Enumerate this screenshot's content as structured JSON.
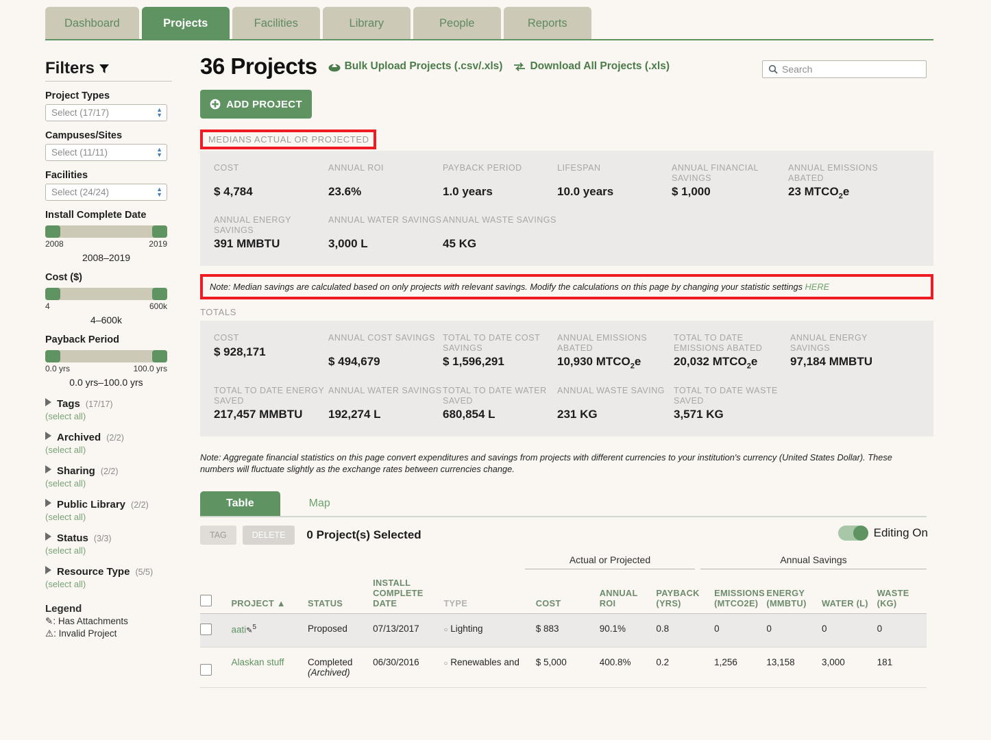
{
  "nav": {
    "tabs": [
      {
        "label": "Dashboard",
        "active": false
      },
      {
        "label": "Projects",
        "active": true
      },
      {
        "label": "Facilities",
        "active": false
      },
      {
        "label": "Library",
        "active": false
      },
      {
        "label": "People",
        "active": false
      },
      {
        "label": "Reports",
        "active": false
      }
    ]
  },
  "sidebar": {
    "heading": "Filters",
    "filter_icon": "funnel-icon",
    "selects": [
      {
        "label": "Project Types",
        "value": "Select (17/17)"
      },
      {
        "label": "Campuses/Sites",
        "value": "Select (11/11)"
      },
      {
        "label": "Facilities",
        "value": "Select (24/24)"
      }
    ],
    "sliders": [
      {
        "label": "Install Complete Date",
        "min": "2008",
        "max": "2019",
        "range": "2008–2019"
      },
      {
        "label": "Cost ($)",
        "min": "4",
        "max": "600k",
        "range": "4–600k"
      },
      {
        "label": "Payback Period",
        "min": "0.0 yrs",
        "max": "100.0 yrs",
        "range": "0.0 yrs–100.0 yrs"
      }
    ],
    "accordions": [
      {
        "title": "Tags",
        "count": "(17/17)",
        "select_all": "(select all)"
      },
      {
        "title": "Archived",
        "count": "(2/2)",
        "select_all": "(select all)"
      },
      {
        "title": "Sharing",
        "count": "(2/2)",
        "select_all": "(select all)"
      },
      {
        "title": "Public Library",
        "count": "(2/2)",
        "select_all": "(select all)"
      },
      {
        "title": "Status",
        "count": "(3/3)",
        "select_all": "(select all)"
      },
      {
        "title": "Resource Type",
        "count": "(5/5)",
        "select_all": "(select all)"
      }
    ],
    "legend": {
      "title": "Legend",
      "items": [
        {
          "icon": "paperclip-icon",
          "glyph": "✎",
          "text": ": Has Attachments"
        },
        {
          "icon": "warning-triangle-icon",
          "glyph": "⚠",
          "text": ": Invalid Project"
        }
      ]
    }
  },
  "header": {
    "title": "36 Projects",
    "bulk_upload": "Bulk Upload Projects (.csv/.xls)",
    "download_all": "Download All Projects (.xls)",
    "add_project": "ADD PROJECT",
    "search_placeholder": "Search",
    "search_value": ""
  },
  "medians": {
    "section_label": "MEDIANS ACTUAL OR PROJECTED",
    "row1": [
      {
        "key": "COST",
        "value": "$ 4,784"
      },
      {
        "key": "ANNUAL ROI",
        "value": "23.6%"
      },
      {
        "key": "PAYBACK PERIOD",
        "value": "1.0 years"
      },
      {
        "key": "LIFESPAN",
        "value": "10.0 years"
      },
      {
        "key": "ANNUAL FINANCIAL SAVINGS",
        "value": "$ 1,000"
      },
      {
        "key": "ANNUAL EMISSIONS ABATED",
        "value": "23 MTCO₂e"
      }
    ],
    "row2": [
      {
        "key": "ANNUAL ENERGY SAVINGS",
        "value": "391 MMBTU"
      },
      {
        "key": "ANNUAL WATER SAVINGS",
        "value": "3,000 L"
      },
      {
        "key": "ANNUAL WASTE SAVINGS",
        "value": "45 KG"
      }
    ],
    "note": "Note: Median savings are calculated based on only projects with relevant savings. Modify the calculations on this page by changing your statistic settings ",
    "note_link": "HERE"
  },
  "totals": {
    "section_label": "TOTALS",
    "row1": [
      {
        "key": "COST",
        "value": "$ 928,171"
      },
      {
        "key": "ANNUAL COST SAVINGS",
        "value": "$ 494,679"
      },
      {
        "key": "TOTAL TO DATE COST SAVINGS",
        "value": "$ 1,596,291"
      },
      {
        "key": "ANNUAL EMISSIONS ABATED",
        "value": "10,930 MTCO₂e"
      },
      {
        "key": "TOTAL TO DATE EMISSIONS ABATED",
        "value": "20,032 MTCO₂e"
      },
      {
        "key": "ANNUAL ENERGY SAVINGS",
        "value": "97,184 MMBTU"
      }
    ],
    "row2": [
      {
        "key": "TOTAL TO DATE ENERGY SAVED",
        "value": "217,457 MMBTU"
      },
      {
        "key": "ANNUAL WATER SAVINGS",
        "value": "192,274 L"
      },
      {
        "key": "TOTAL TO DATE WATER SAVED",
        "value": "680,854 L"
      },
      {
        "key": "ANNUAL WASTE SAVING",
        "value": "231 KG"
      },
      {
        "key": "TOTAL TO DATE WASTE SAVED",
        "value": "3,571 KG"
      }
    ]
  },
  "aggregate_note": "Note: Aggregate financial statistics on this page convert expenditures and savings from projects with different currencies to your institution's currency (United States Dollar). These numbers will fluctuate slightly as the exchange rates between currencies change.",
  "view_tabs": [
    {
      "label": "Table",
      "active": true
    },
    {
      "label": "Map",
      "active": false
    }
  ],
  "actions": {
    "tag": "TAG",
    "delete": "DELETE",
    "selected_count": "0 Project(s) Selected",
    "editing_label": "Editing On",
    "editing_on": true
  },
  "table": {
    "group_headers": [
      {
        "label": "Actual or Projected"
      },
      {
        "label": "Annual Savings"
      }
    ],
    "columns": [
      {
        "label": "PROJECT ▲",
        "muted": false
      },
      {
        "label": "STATUS",
        "muted": false
      },
      {
        "label": "INSTALL COMPLETE DATE",
        "muted": false
      },
      {
        "label": "TYPE",
        "muted": true
      },
      {
        "label": "COST",
        "muted": false
      },
      {
        "label": "ANNUAL ROI",
        "muted": false
      },
      {
        "label": "PAYBACK (YRS)",
        "muted": false
      },
      {
        "label": "EMISSIONS (MTCO2E)",
        "muted": false
      },
      {
        "label": "ENERGY (MMBTU)",
        "muted": false
      },
      {
        "label": "WATER (L)",
        "muted": false
      },
      {
        "label": "WASTE (KG)",
        "muted": false
      }
    ],
    "rows": [
      {
        "project": "aati",
        "attachment_glyph": "✎",
        "superscript": "5",
        "status": "Proposed",
        "status_sub": "",
        "date": "07/13/2017",
        "type": "Lighting",
        "cost": "$ 883",
        "roi": "90.1%",
        "payback": "0.8",
        "emissions": "0",
        "energy": "0",
        "water": "0",
        "waste": "0",
        "shaded": true
      },
      {
        "project": "Alaskan stuff",
        "attachment_glyph": "",
        "superscript": "",
        "status": "Completed",
        "status_sub": "(Archived)",
        "date": "06/30/2016",
        "type": "Renewables and",
        "cost": "$ 5,000",
        "roi": "400.8%",
        "payback": "0.2",
        "emissions": "1,256",
        "energy": "13,158",
        "water": "3,000",
        "waste": "181",
        "shaded": false
      }
    ]
  }
}
